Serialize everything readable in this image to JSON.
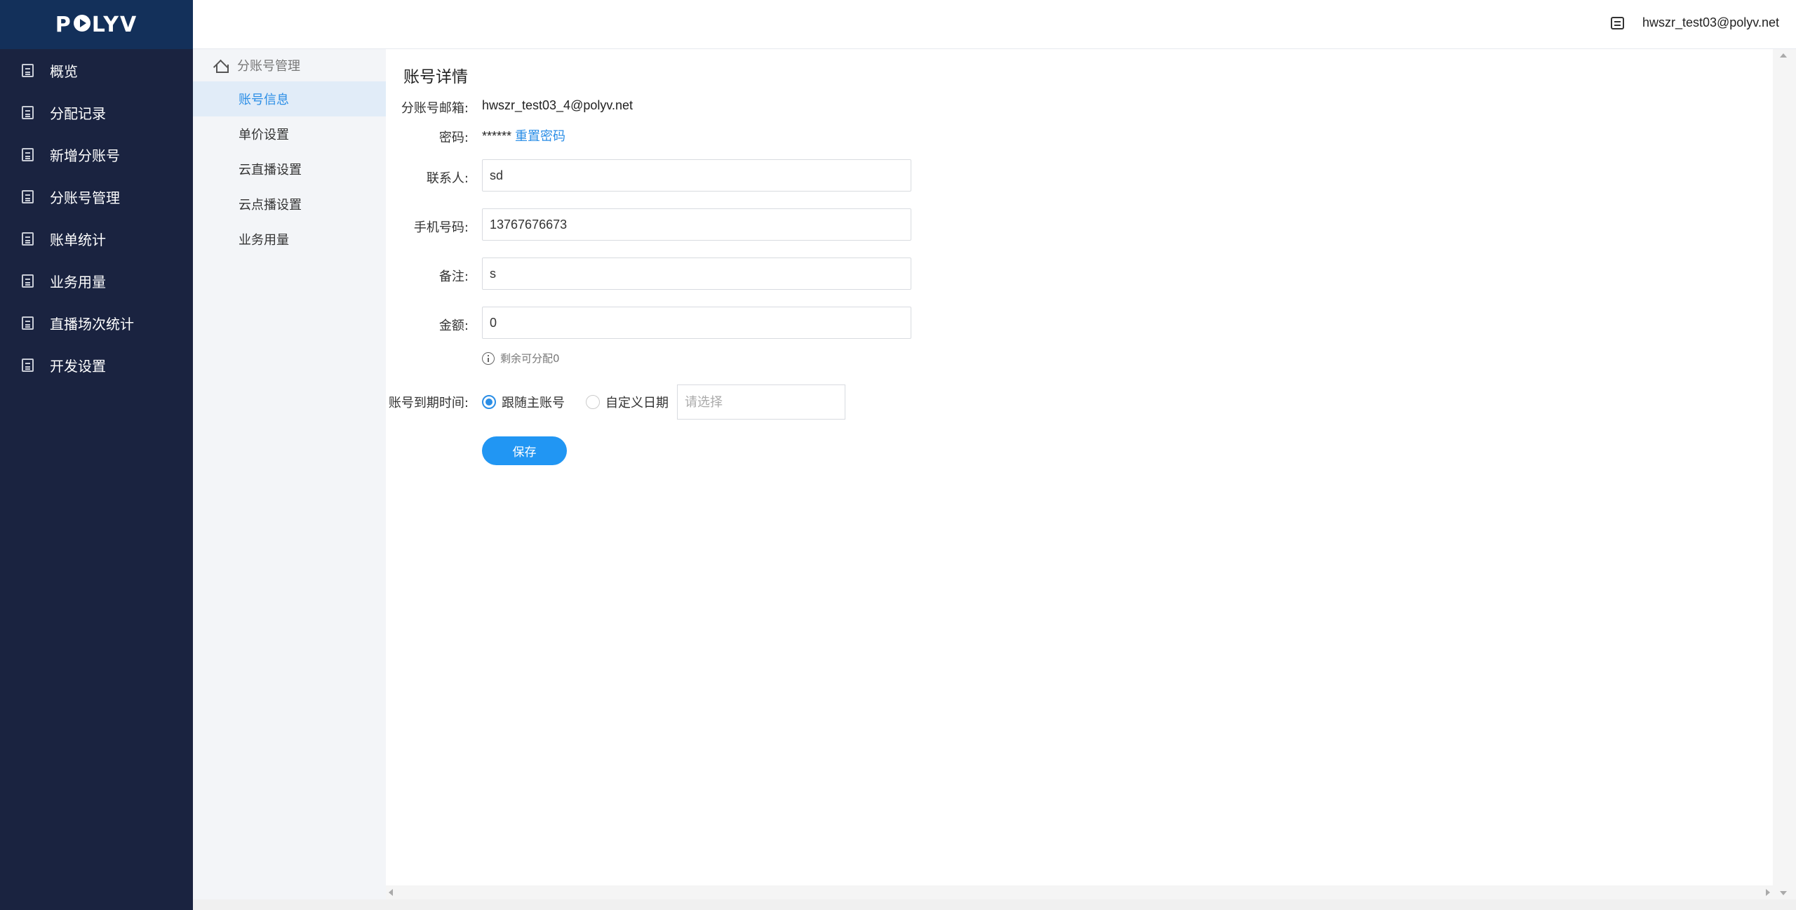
{
  "sidebar": {
    "logo": "POLYV",
    "items": [
      {
        "label": "概览"
      },
      {
        "label": "分配记录"
      },
      {
        "label": "新增分账号"
      },
      {
        "label": "分账号管理"
      },
      {
        "label": "账单统计"
      },
      {
        "label": "业务用量"
      },
      {
        "label": "直播场次统计"
      },
      {
        "label": "开发设置"
      }
    ]
  },
  "header": {
    "user_email": "hwszr_test03@polyv.net",
    "message_icon": "message-icon"
  },
  "subnav": {
    "breadcrumb": "分账号管理",
    "items": [
      {
        "label": "账号信息",
        "active": true
      },
      {
        "label": "单价设置"
      },
      {
        "label": "云直播设置"
      },
      {
        "label": "云点播设置"
      },
      {
        "label": "业务用量"
      }
    ]
  },
  "form": {
    "title": "账号详情",
    "email_label": "分账号邮箱:",
    "email_value": "hwszr_test03_4@polyv.net",
    "password_label": "密码:",
    "password_value": "******",
    "reset_password": "重置密码",
    "contact_label": "联系人:",
    "contact_value": "sd",
    "phone_label": "手机号码:",
    "phone_value": "13767676673",
    "remark_label": "备注:",
    "remark_value": "s",
    "amount_label": "金额:",
    "amount_value": "0",
    "amount_hint": "剩余可分配0",
    "expire_label": "账号到期时间:",
    "expire_option_follow": "跟随主账号",
    "expire_option_custom": "自定义日期",
    "date_placeholder": "请选择",
    "save_button": "保存"
  },
  "colors": {
    "sidebar_bg": "#1a2340",
    "accent": "#2196f3"
  }
}
